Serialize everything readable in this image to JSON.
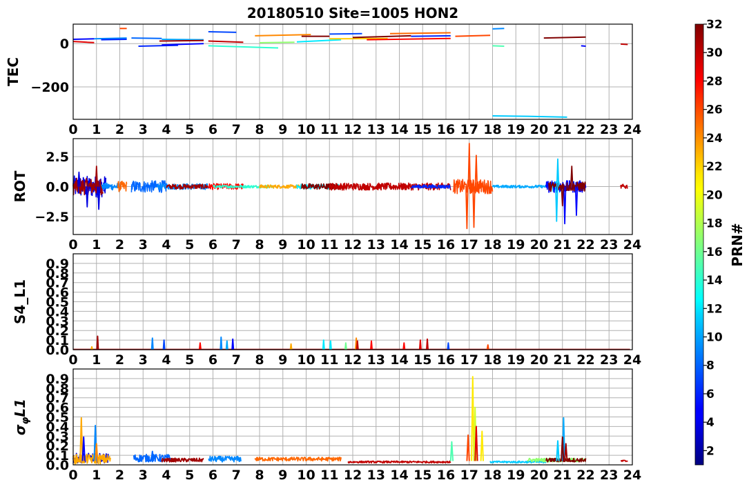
{
  "figure": {
    "title": "20180510 Site=1005 HON2",
    "colorbar": {
      "label": "PRN#",
      "min": 1,
      "max": 32,
      "ticks": [
        2,
        4,
        6,
        8,
        10,
        12,
        14,
        16,
        18,
        20,
        22,
        24,
        26,
        28,
        30,
        32
      ]
    }
  },
  "chart_data": [
    {
      "type": "line",
      "title": "20180510 Site=1005 HON2",
      "xlabel": "",
      "ylabel": "TEC",
      "xlim": [
        0,
        24
      ],
      "ylim": [
        -350,
        90
      ],
      "xticks": [
        "0",
        "1",
        "2",
        "3",
        "4",
        "5",
        "6",
        "7",
        "8",
        "9",
        "10",
        "11",
        "12",
        "13",
        "14",
        "15",
        "16",
        "17",
        "18",
        "19",
        "20",
        "21",
        "22",
        "23",
        "24"
      ],
      "yticks": [
        0,
        -200
      ],
      "grid": true,
      "series": [
        {
          "prn": 5,
          "x": [
            0.0,
            0.9
          ],
          "y": [
            20,
            22
          ]
        },
        {
          "prn": 29,
          "x": [
            0.0,
            0.35,
            0.6,
            0.9
          ],
          "y": [
            10,
            8,
            6,
            5
          ]
        },
        {
          "prn": 9,
          "x": [
            0.9,
            2.3
          ],
          "y": [
            22,
            26
          ]
        },
        {
          "prn": 6,
          "x": [
            1.2,
            2.3
          ],
          "y": [
            18,
            20
          ]
        },
        {
          "prn": 26,
          "x": [
            2.0,
            2.3
          ],
          "y": [
            70,
            70
          ]
        },
        {
          "prn": 8,
          "x": [
            2.5,
            3.8
          ],
          "y": [
            26,
            24
          ]
        },
        {
          "prn": 6,
          "x": [
            2.8,
            4.5
          ],
          "y": [
            -12,
            -8
          ]
        },
        {
          "prn": 10,
          "x": [
            3.8,
            5.6
          ],
          "y": [
            20,
            18
          ]
        },
        {
          "prn": 5,
          "x": [
            3.8,
            5.6
          ],
          "y": [
            -6,
            0
          ]
        },
        {
          "prn": 31,
          "x": [
            3.7,
            5.6
          ],
          "y": [
            12,
            14
          ]
        },
        {
          "prn": 7,
          "x": [
            5.8,
            7.0
          ],
          "y": [
            55,
            52
          ]
        },
        {
          "prn": 30,
          "x": [
            5.8,
            7.3
          ],
          "y": [
            12,
            6
          ]
        },
        {
          "prn": 14,
          "x": [
            5.8,
            8.8
          ],
          "y": [
            -10,
            -20
          ]
        },
        {
          "prn": 24,
          "x": [
            7.8,
            10.2
          ],
          "y": [
            36,
            42
          ]
        },
        {
          "prn": 17,
          "x": [
            8.0,
            9.5
          ],
          "y": [
            4,
            6
          ]
        },
        {
          "prn": 12,
          "x": [
            9.6,
            11.5
          ],
          "y": [
            8,
            18
          ]
        },
        {
          "prn": 32,
          "x": [
            9.8,
            11.0
          ],
          "y": [
            34,
            34
          ]
        },
        {
          "prn": 22,
          "x": [
            11.0,
            13.5
          ],
          "y": [
            22,
            24
          ]
        },
        {
          "prn": 7,
          "x": [
            11.0,
            12.4
          ],
          "y": [
            44,
            46
          ]
        },
        {
          "prn": 32,
          "x": [
            12.0,
            14.5
          ],
          "y": [
            28,
            36
          ]
        },
        {
          "prn": 28,
          "x": [
            12.6,
            16.2
          ],
          "y": [
            18,
            24
          ]
        },
        {
          "prn": 25,
          "x": [
            13.6,
            16.2
          ],
          "y": [
            46,
            50
          ]
        },
        {
          "prn": 6,
          "x": [
            14.5,
            16.2
          ],
          "y": [
            34,
            36
          ]
        },
        {
          "prn": 26,
          "x": [
            16.4,
            17.9
          ],
          "y": [
            34,
            38
          ]
        },
        {
          "prn": 9,
          "x": [
            18.0,
            18.5
          ],
          "y": [
            68,
            70
          ]
        },
        {
          "prn": 15,
          "x": [
            18.0,
            18.5
          ],
          "y": [
            -10,
            -12
          ]
        },
        {
          "prn": 11,
          "x": [
            18.0,
            19.5,
            21.2
          ],
          "y": [
            -334,
            -336,
            -340
          ]
        },
        {
          "prn": 32,
          "x": [
            20.2,
            22.0
          ],
          "y": [
            26,
            30
          ]
        },
        {
          "prn": 5,
          "x": [
            21.8,
            22.0
          ],
          "y": [
            -10,
            -12
          ]
        },
        {
          "prn": 30,
          "x": [
            23.5,
            23.8
          ],
          "y": [
            -2,
            -4
          ]
        }
      ]
    },
    {
      "type": "line",
      "xlabel": "",
      "ylabel": "ROT",
      "xlim": [
        0,
        24
      ],
      "ylim": [
        -4,
        4
      ],
      "xticks": [
        "0",
        "1",
        "2",
        "3",
        "4",
        "5",
        "6",
        "7",
        "8",
        "9",
        "10",
        "11",
        "12",
        "13",
        "14",
        "15",
        "16",
        "17",
        "18",
        "19",
        "20",
        "21",
        "22",
        "23",
        "24"
      ],
      "yticks": [
        2.5,
        0.0,
        -2.5
      ],
      "ytick_labels": [
        "2.5",
        "0.0",
        "−2.5"
      ],
      "grid": true,
      "series": [
        {
          "prn": 4,
          "t0": 0.0,
          "t1": 1.4,
          "amp": 0.9
        },
        {
          "prn": 31,
          "t0": 0.0,
          "t1": 1.3,
          "amp": 0.7
        },
        {
          "prn": 9,
          "t0": 1.2,
          "t1": 2.0,
          "amp": 0.3
        },
        {
          "prn": 25,
          "t0": 1.9,
          "t1": 2.3,
          "amp": 0.45
        },
        {
          "prn": 8,
          "t0": 2.5,
          "t1": 4.0,
          "amp": 0.5
        },
        {
          "prn": 9,
          "t0": 3.6,
          "t1": 5.8,
          "amp": 0.25
        },
        {
          "prn": 31,
          "t0": 4.0,
          "t1": 5.8,
          "amp": 0.2
        },
        {
          "prn": 28,
          "t0": 5.8,
          "t1": 7.3,
          "amp": 0.25
        },
        {
          "prn": 14,
          "t0": 6.0,
          "t1": 8.6,
          "amp": 0.12
        },
        {
          "prn": 23,
          "t0": 8.0,
          "t1": 10.0,
          "amp": 0.15
        },
        {
          "prn": 12,
          "t0": 9.6,
          "t1": 11.5,
          "amp": 0.2
        },
        {
          "prn": 32,
          "t0": 9.8,
          "t1": 11.5,
          "amp": 0.25
        },
        {
          "prn": 30,
          "t0": 11.0,
          "t1": 16.2,
          "amp": 0.3
        },
        {
          "prn": 6,
          "t0": 14.5,
          "t1": 16.2,
          "amp": 0.15
        },
        {
          "prn": 26,
          "t0": 16.3,
          "t1": 18.0,
          "amp": 0.6
        },
        {
          "prn": 10,
          "t0": 18.0,
          "t1": 20.5,
          "amp": 0.12
        },
        {
          "prn": 11,
          "t0": 20.5,
          "t1": 20.9,
          "amp": 0.6
        },
        {
          "prn": 5,
          "t0": 20.3,
          "t1": 22.0,
          "amp": 0.5
        },
        {
          "prn": 32,
          "t0": 20.4,
          "t1": 22.0,
          "amp": 0.4
        },
        {
          "prn": 30,
          "t0": 23.5,
          "t1": 23.8,
          "amp": 0.2
        }
      ],
      "spikes": [
        {
          "prn": 4,
          "x": 0.25,
          "y": 1.2
        },
        {
          "prn": 4,
          "x": 0.6,
          "y": -1.7
        },
        {
          "prn": 31,
          "x": 1.0,
          "y": 1.7
        },
        {
          "prn": 4,
          "x": 1.1,
          "y": -1.9
        },
        {
          "prn": 26,
          "x": 17.0,
          "y": 3.6
        },
        {
          "prn": 26,
          "x": 16.9,
          "y": -3.5
        },
        {
          "prn": 26,
          "x": 17.2,
          "y": -3.4
        },
        {
          "prn": 26,
          "x": 17.3,
          "y": 2.6
        },
        {
          "prn": 11,
          "x": 20.8,
          "y": 2.3
        },
        {
          "prn": 11,
          "x": 20.75,
          "y": -2.9
        },
        {
          "prn": 5,
          "x": 21.1,
          "y": -3.1
        },
        {
          "prn": 32,
          "x": 21.4,
          "y": 1.7
        },
        {
          "prn": 5,
          "x": 21.6,
          "y": -2.4
        },
        {
          "prn": 32,
          "x": 21.0,
          "y": -1.6
        }
      ]
    },
    {
      "type": "line",
      "xlabel": "",
      "ylabel": "S4_L1",
      "xlim": [
        0,
        24
      ],
      "ylim": [
        0,
        1
      ],
      "xticks": [
        "0",
        "1",
        "2",
        "3",
        "4",
        "5",
        "6",
        "7",
        "8",
        "9",
        "10",
        "11",
        "12",
        "13",
        "14",
        "15",
        "16",
        "17",
        "18",
        "19",
        "20",
        "21",
        "22",
        "23",
        "24"
      ],
      "yticks": [
        0.0,
        0.1,
        0.2,
        0.3,
        0.4,
        0.5,
        0.6,
        0.7,
        0.8,
        0.9
      ],
      "grid": true,
      "baseline": 0.003,
      "spikes": [
        {
          "prn": 31,
          "x": 1.05,
          "y": 0.14
        },
        {
          "prn": 23,
          "x": 0.8,
          "y": 0.03
        },
        {
          "prn": 9,
          "x": 3.4,
          "y": 0.12
        },
        {
          "prn": 7,
          "x": 3.9,
          "y": 0.1
        },
        {
          "prn": 28,
          "x": 5.45,
          "y": 0.07
        },
        {
          "prn": 9,
          "x": 6.35,
          "y": 0.13
        },
        {
          "prn": 10,
          "x": 6.6,
          "y": 0.09
        },
        {
          "prn": 5,
          "x": 6.85,
          "y": 0.11
        },
        {
          "prn": 23,
          "x": 9.35,
          "y": 0.06
        },
        {
          "prn": 12,
          "x": 10.75,
          "y": 0.1
        },
        {
          "prn": 12,
          "x": 11.05,
          "y": 0.09
        },
        {
          "prn": 16,
          "x": 11.7,
          "y": 0.07
        },
        {
          "prn": 24,
          "x": 12.15,
          "y": 0.12
        },
        {
          "prn": 30,
          "x": 12.2,
          "y": 0.09
        },
        {
          "prn": 28,
          "x": 12.8,
          "y": 0.09
        },
        {
          "prn": 28,
          "x": 14.2,
          "y": 0.07
        },
        {
          "prn": 29,
          "x": 14.9,
          "y": 0.1
        },
        {
          "prn": 30,
          "x": 15.2,
          "y": 0.11
        },
        {
          "prn": 7,
          "x": 16.1,
          "y": 0.07
        },
        {
          "prn": 26,
          "x": 17.8,
          "y": 0.05
        }
      ]
    },
    {
      "type": "line",
      "xlabel": "",
      "ylabel": "σφL1",
      "xlim": [
        0,
        24
      ],
      "ylim": [
        0,
        1
      ],
      "xticks": [
        "0",
        "1",
        "2",
        "3",
        "4",
        "5",
        "6",
        "7",
        "8",
        "9",
        "10",
        "11",
        "12",
        "13",
        "14",
        "15",
        "16",
        "17",
        "18",
        "19",
        "20",
        "21",
        "22",
        "23",
        "24"
      ],
      "yticks": [
        0.0,
        0.1,
        0.2,
        0.3,
        0.4,
        0.5,
        0.6,
        0.7,
        0.8,
        0.9
      ],
      "grid": true,
      "series": [
        {
          "prn": 4,
          "t0": 0.0,
          "t1": 1.5,
          "base": 0.07,
          "amp": 0.05
        },
        {
          "prn": 23,
          "t0": 0.0,
          "t1": 1.6,
          "base": 0.06,
          "amp": 0.05
        },
        {
          "prn": 8,
          "t0": 2.6,
          "t1": 4.2,
          "base": 0.07,
          "amp": 0.04
        },
        {
          "prn": 31,
          "t0": 3.8,
          "t1": 5.6,
          "base": 0.05,
          "amp": 0.02
        },
        {
          "prn": 9,
          "t0": 5.8,
          "t1": 7.2,
          "base": 0.06,
          "amp": 0.03
        },
        {
          "prn": 25,
          "t0": 7.8,
          "t1": 11.5,
          "base": 0.06,
          "amp": 0.02
        },
        {
          "prn": 30,
          "t0": 11.8,
          "t1": 16.2,
          "base": 0.03,
          "amp": 0.01
        },
        {
          "prn": 11,
          "t0": 17.9,
          "t1": 20.3,
          "base": 0.03,
          "amp": 0.01
        },
        {
          "prn": 17,
          "t0": 19.5,
          "t1": 22.0,
          "base": 0.05,
          "amp": 0.02
        },
        {
          "prn": 32,
          "t0": 20.3,
          "t1": 22.0,
          "base": 0.05,
          "amp": 0.02
        },
        {
          "prn": 30,
          "t0": 23.5,
          "t1": 23.8,
          "base": 0.04,
          "amp": 0.01
        }
      ],
      "spikes": [
        {
          "prn": 23,
          "x": 0.35,
          "y": 0.49
        },
        {
          "prn": 5,
          "x": 0.45,
          "y": 0.29
        },
        {
          "prn": 9,
          "x": 0.95,
          "y": 0.41
        },
        {
          "prn": 24,
          "x": 1.0,
          "y": 0.22
        },
        {
          "prn": 8,
          "x": 3.4,
          "y": 0.14
        },
        {
          "prn": 15,
          "x": 16.25,
          "y": 0.24
        },
        {
          "prn": 26,
          "x": 16.95,
          "y": 0.31
        },
        {
          "prn": 21,
          "x": 17.15,
          "y": 0.92
        },
        {
          "prn": 19,
          "x": 17.25,
          "y": 0.6
        },
        {
          "prn": 29,
          "x": 17.3,
          "y": 0.4
        },
        {
          "prn": 21,
          "x": 17.55,
          "y": 0.35
        },
        {
          "prn": 11,
          "x": 20.8,
          "y": 0.25
        },
        {
          "prn": 10,
          "x": 21.05,
          "y": 0.49
        },
        {
          "prn": 32,
          "x": 21.0,
          "y": 0.29
        },
        {
          "prn": 31,
          "x": 21.15,
          "y": 0.22
        }
      ]
    }
  ]
}
